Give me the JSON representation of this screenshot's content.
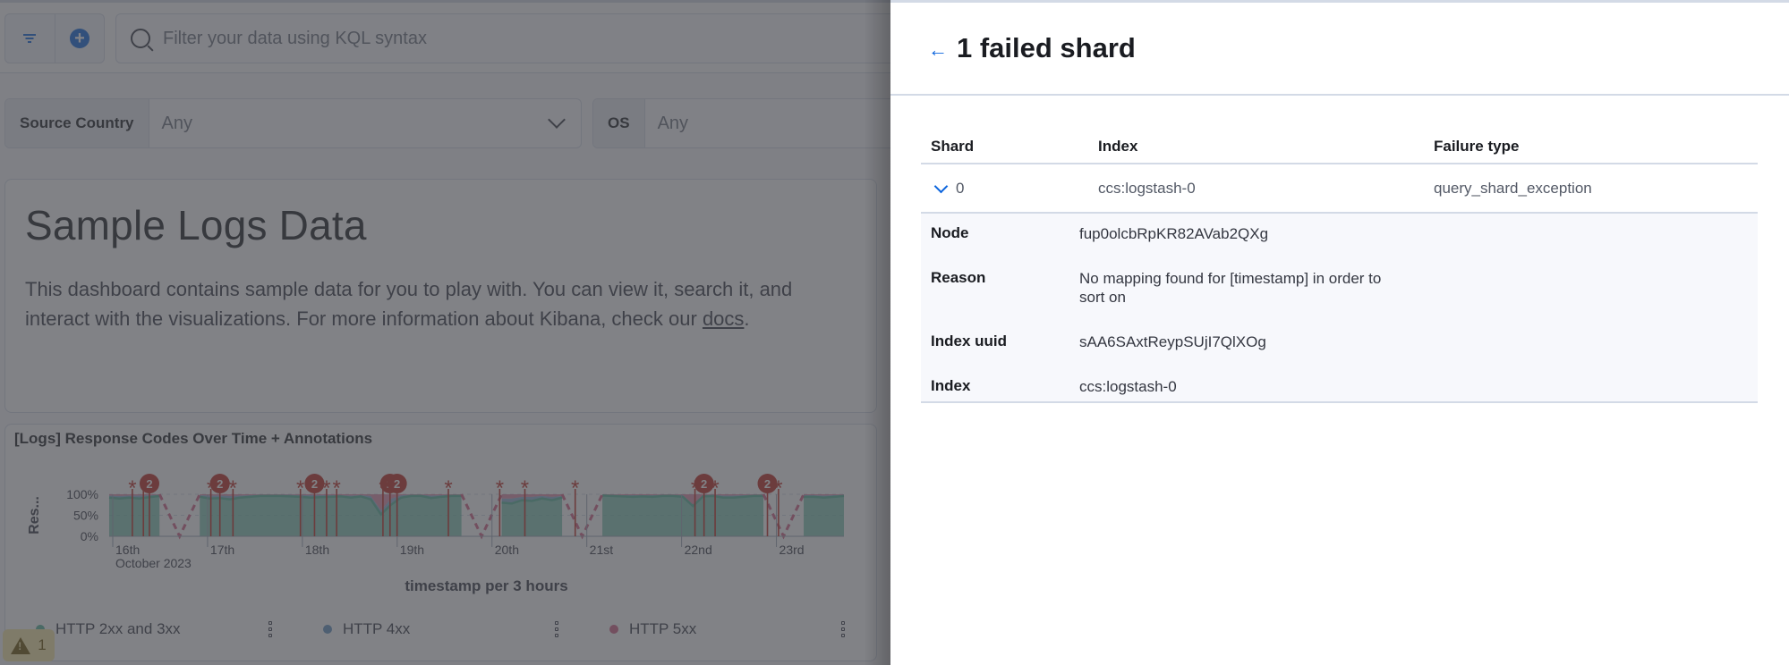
{
  "query_bar": {
    "filter_button_icon": "filter-icon",
    "add_filter_icon": "plus-in-circle-icon",
    "search_icon": "search-icon",
    "placeholder": "Filter your data using KQL syntax"
  },
  "controls": [
    {
      "label": "Source Country",
      "value": "Any"
    },
    {
      "label": "OS",
      "value": "Any"
    }
  ],
  "markdown_panel": {
    "title": "Sample Logs Data",
    "body_before_link": "This dashboard contains sample data for you to play with. You can view it, search it, and interact with the visualizations. For more information about Kibana, check our ",
    "link_text": "docs",
    "body_after_link": "."
  },
  "vis_panel": {
    "title": "[Logs] Response Codes Over Time + Annotations",
    "warning_count": "1"
  },
  "chart_data": {
    "type": "area",
    "title": "[Logs] Response Codes Over Time + Annotations",
    "xlabel": "timestamp per 3 hours",
    "ylabel": "Res...",
    "y_ticks": [
      "100%",
      "50%",
      "0%"
    ],
    "ylim": [
      0,
      100
    ],
    "x_ticks": [
      "16th",
      "17th",
      "18th",
      "19th",
      "20th",
      "21st",
      "22nd",
      "23rd"
    ],
    "x_sublabel": "October 2023",
    "legend_position": "bottom",
    "series": [
      {
        "name": "HTTP 2xx and 3xx",
        "color": "#54b399",
        "values": [
          92,
          90,
          92,
          90,
          93,
          96,
          null,
          null,
          null,
          94,
          90,
          91,
          88,
          92,
          94,
          96,
          96,
          96,
          95,
          94,
          92,
          93,
          94,
          95,
          92,
          95,
          88,
          52,
          75,
          92,
          96,
          96,
          91,
          94,
          96,
          96,
          null,
          null,
          null,
          80,
          78,
          86,
          84,
          90,
          86,
          92,
          null,
          null,
          null,
          97,
          96,
          95,
          94,
          95,
          94,
          96,
          96,
          94,
          72,
          95,
          96,
          92,
          92,
          94,
          96,
          96,
          null,
          null,
          null,
          94,
          94,
          92,
          94,
          96
        ]
      },
      {
        "name": "HTTP 4xx",
        "color": "#6092c0",
        "values": [
          5,
          6,
          5,
          7,
          5,
          3,
          null,
          null,
          null,
          4,
          7,
          6,
          8,
          5,
          4,
          3,
          3,
          3,
          4,
          4,
          6,
          5,
          4,
          3,
          5,
          3,
          8,
          10,
          14,
          6,
          3,
          3,
          6,
          4,
          3,
          3,
          null,
          null,
          null,
          10,
          12,
          8,
          10,
          6,
          8,
          4,
          null,
          null,
          null,
          2,
          3,
          3,
          4,
          3,
          4,
          3,
          3,
          4,
          3,
          3,
          3,
          5,
          5,
          4,
          3,
          3,
          null,
          null,
          null,
          4,
          4,
          5,
          4,
          3
        ]
      },
      {
        "name": "HTTP 5xx",
        "color": "#d36086",
        "values": [
          3,
          4,
          3,
          3,
          2,
          1,
          null,
          null,
          null,
          2,
          3,
          3,
          4,
          3,
          2,
          1,
          1,
          1,
          1,
          2,
          2,
          2,
          2,
          2,
          3,
          2,
          4,
          38,
          11,
          2,
          1,
          1,
          3,
          2,
          1,
          1,
          null,
          null,
          null,
          10,
          10,
          6,
          6,
          4,
          6,
          4,
          null,
          null,
          null,
          1,
          1,
          2,
          2,
          2,
          2,
          1,
          1,
          2,
          25,
          2,
          1,
          3,
          3,
          2,
          1,
          1,
          null,
          null,
          null,
          2,
          2,
          3,
          2,
          1
        ]
      }
    ],
    "annotations": [
      {
        "x_index": 2.3,
        "label": "*"
      },
      {
        "x_index": 3.4,
        "label": "*"
      },
      {
        "x_index": 4.0,
        "label": "2"
      },
      {
        "x_index": 10.1,
        "label": "*"
      },
      {
        "x_index": 11.0,
        "label": "2"
      },
      {
        "x_index": 12.3,
        "label": "*"
      },
      {
        "x_index": 19.0,
        "label": "*"
      },
      {
        "x_index": 20.4,
        "label": "2"
      },
      {
        "x_index": 21.6,
        "label": "*"
      },
      {
        "x_index": 22.6,
        "label": "*"
      },
      {
        "x_index": 27.2,
        "label": "*"
      },
      {
        "x_index": 27.9,
        "label": "2"
      },
      {
        "x_index": 28.6,
        "label": "2"
      },
      {
        "x_index": 33.7,
        "label": "*"
      },
      {
        "x_index": 38.8,
        "label": "*"
      },
      {
        "x_index": 41.3,
        "label": "*"
      },
      {
        "x_index": 46.3,
        "label": "*"
      },
      {
        "x_index": 58.2,
        "label": "*"
      },
      {
        "x_index": 59.1,
        "label": "2"
      },
      {
        "x_index": 60.2,
        "label": "*"
      },
      {
        "x_index": 65.4,
        "label": "2"
      },
      {
        "x_index": 66.5,
        "label": "*"
      }
    ],
    "annotation_color": "#bd271e"
  },
  "legend": [
    {
      "label": "HTTP 2xx and 3xx",
      "color": "#54b399"
    },
    {
      "label": "HTTP 4xx",
      "color": "#6092c0"
    },
    {
      "label": "HTTP 5xx",
      "color": "#d36086"
    }
  ],
  "flyout": {
    "back_icon": "arrow-left-icon",
    "title": "1 failed shard",
    "columns": [
      "Shard",
      "Index",
      "Failure type"
    ],
    "rows": [
      {
        "shard": "0",
        "index": "ccs:logstash-0",
        "failure_type": "query_shard_exception",
        "expanded": true
      }
    ],
    "details": [
      {
        "key": "Node",
        "value": "fup0olcbRpKR82AVab2QXg"
      },
      {
        "key": "Reason",
        "value": "No mapping found for [timestamp] in order to sort on"
      },
      {
        "key": "Index uuid",
        "value": "sAA6SAxtReypSUjI7QlXOg"
      },
      {
        "key": "Index",
        "value": "ccs:logstash-0"
      }
    ]
  }
}
